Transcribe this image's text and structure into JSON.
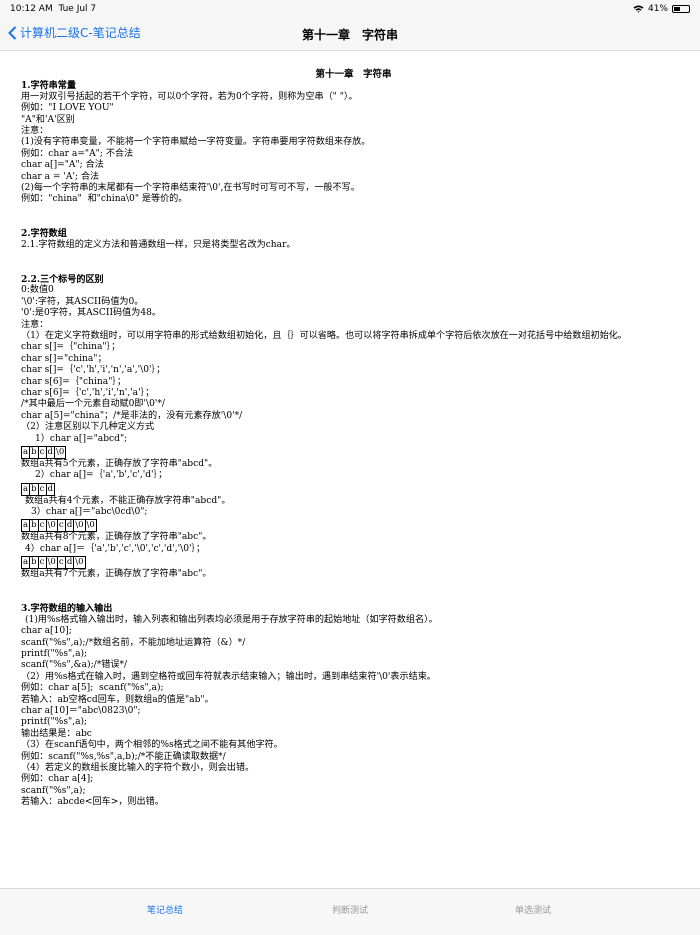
{
  "status": {
    "time": "10:12 AM",
    "date": "Tue Jul 7",
    "battery": "41%",
    "battery_level": 0.41
  },
  "nav": {
    "back_label": "计算机二级C-笔记总结",
    "title": "第十一章　字符串"
  },
  "doc": {
    "chapter_title": "第十一章　字符串",
    "lines": [
      "1.字符串常量",
      "用一对双引号括起的若干个字符，可以0个字符，若为0个字符，则称为空串（\" \"）。",
      "例如：\"I LOVE YOU\"",
      "\"A\"和'A'区别",
      "注意：",
      "(1)没有字符串变量，不能将一个字符串赋给一字符变量。字符串要用字符数组来存放。",
      "例如：char a=\"A\"; 不合法",
      "char a[]=\"A\"; 合法",
      "char a = 'A'; 合法",
      "(2)每一个字符串的末尾都有一个字符串结束符'\\0',在书写时可写可不写，一般不写。",
      "例如：\"china\"  和\"china\\0\" 是等价的。",
      "2.字符数组",
      "2.1.字符数组的定义方法和普通数组一样，只是将类型名改为char。",
      "2.2.三个标号的区别",
      "0:数值0",
      "'\\0':字符，其ASCII码值为0。",
      "'0':是0字符，其ASCII码值为48。",
      "注意：",
      "（1）在定义字符数组时，可以用字符串的形式给数组初始化，且｛｝可以省略。也可以将字符串拆成单个字符后依次放在一对花括号中给数组初始化。",
      "char s[]=｛\"china\"｝；",
      "char s[]=\"china\"；",
      "char s[]=｛'c','h','i','n','a','\\0'｝；",
      "char s[6]=｛\"china\"｝；",
      "char s[6]=｛'c','h','i','n','a'｝；",
      "/*其中最后一个元素自动赋0即'\\0'*/",
      "char a[5]=\"china\"；/*是非法的，没有元素存放'\\0'*/",
      "（2）注意区别以下几种定义方式",
      "1）char a[]=\"abcd\";",
      "数组a共有5个元素，正确存放了字符串\"abcd\"。",
      "2）char a[]=｛'a','b','c','d'｝；",
      "数组a共有4个元素，不能正确存放字符串\"abcd\"。",
      "3）char a[]＝\"abc\\0cd\\0\";",
      "数组a共有8个元素，正确存放了字符串\"abc\"。",
      "4）char a[]＝｛'a','b','c','\\0','c','d','\\0'｝；",
      "数组a共有7个元素，正确存放了字符串\"abc\"。",
      "3.字符数组的输入输出",
      "(1)用%s格式输入输出时，输入列表和输出列表均必须是用于存放字符串的起始地址（如字符数组名）。",
      "char a[10];",
      "scanf(\"%s\",a);/*数组名前，不能加地址运算符（&）*/",
      "printf(\"%s\",a);",
      "scanf(\"%s\",&a);/*错误*/",
      "（2）用%s格式在输入时，遇到空格符或回车符就表示结束输入；输出时，遇到串结束符'\\0'表示结束。",
      "例如：char a[5];  scanf(\"%s\",a);",
      "若输入：ab空格cd回车，则数组a的值是\"ab\"。",
      "char a[10]＝\"abc\\0823\\0\";",
      "printf(\"%s\",a);",
      "输出结果是：abc",
      "（3）在scanf语句中，两个相邻的%s格式之间不能有其他字符。",
      "例如：scanf(\"%s,%s\",a,b);/*不能正确读取数据*/",
      "（4）若定义的数组长度比输入的字符个数小，则会出错。",
      "例如：char a[4];",
      "scanf(\"%s\",a);",
      "若输入：abcde<回车>，则出错。"
    ],
    "boxes": [
      [
        "a",
        "b",
        "c",
        "d",
        "\\0"
      ],
      [
        "a",
        "b",
        "c",
        "d"
      ],
      [
        "a",
        "b",
        "c",
        "\\0",
        "c",
        "d",
        "\\0",
        "\\0"
      ],
      [
        "a",
        "b",
        "c",
        "\\0",
        "c",
        "d",
        "\\0"
      ]
    ]
  },
  "tabs": [
    {
      "label": "笔记总结",
      "color": "#1a73e8"
    },
    {
      "label": "判断测试",
      "color": "#999999"
    },
    {
      "label": "单选测试",
      "color": "#999999"
    }
  ]
}
